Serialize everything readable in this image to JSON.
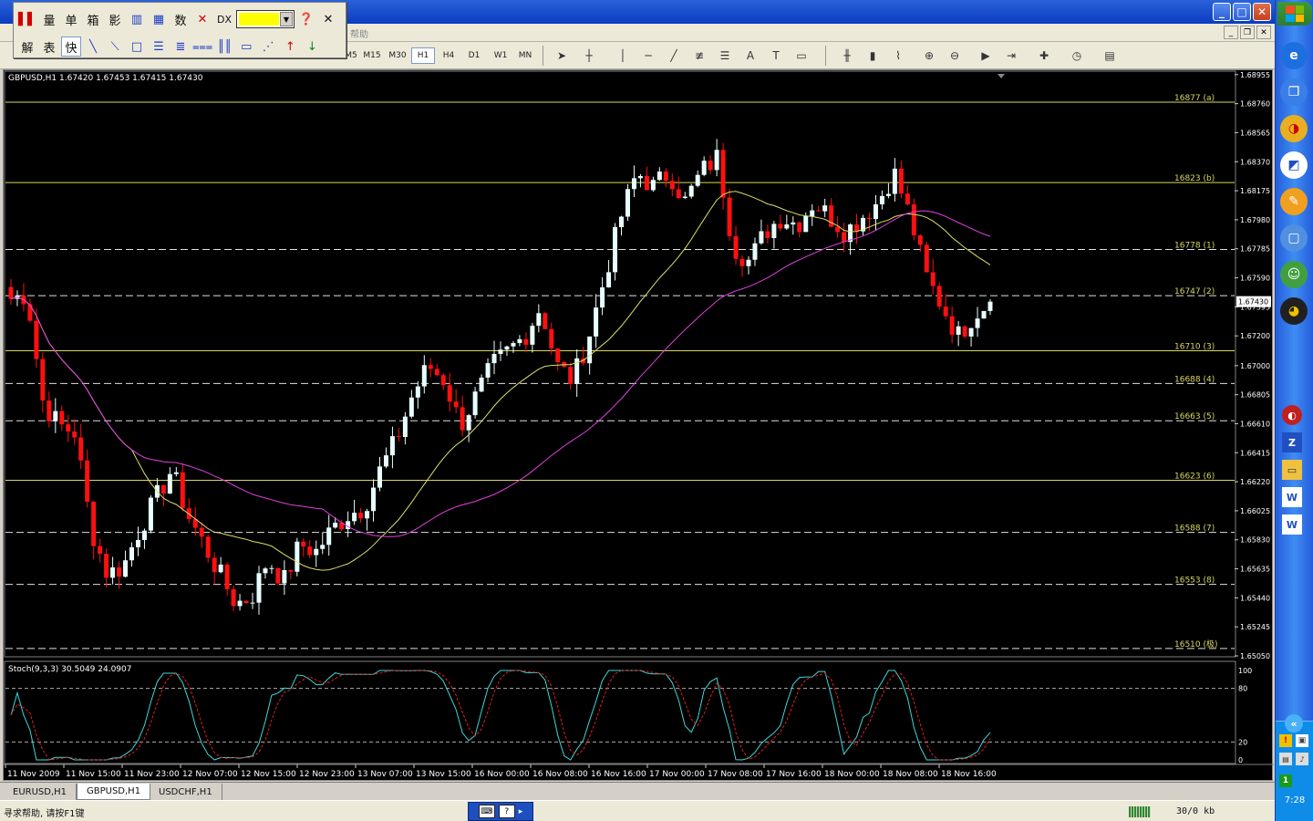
{
  "window": {
    "min_label": "_",
    "max_label": "□",
    "close_label": "✕"
  },
  "menubar": {
    "partial_label": "帮助"
  },
  "floating_toolbar": {
    "row1": [
      "量",
      "单",
      "箱",
      "影",
      "数"
    ],
    "row1_dx": "DX",
    "row2": [
      "解",
      "表",
      "快"
    ],
    "color": "#ffff00"
  },
  "toolbar": {
    "timeframes": [
      "M5",
      "M15",
      "M30",
      "H1",
      "H4",
      "D1",
      "W1",
      "MN"
    ],
    "active_timeframe": "H1"
  },
  "chart": {
    "symbol_info": "GBPUSD,H1  1.67420 1.67453 1.67415 1.67430",
    "current_price": "1.67430",
    "indicator_info": "Stoch(9,3,3) 30.5049 24.0907"
  },
  "chart_data": {
    "type": "candlestick",
    "symbol": "GBPUSD",
    "timeframe": "H1",
    "price_axis_ticks": [
      "1.68955",
      "1.68760",
      "1.68565",
      "1.68370",
      "1.68175",
      "1.67980",
      "1.67785",
      "1.67590",
      "1.67395",
      "1.67200",
      "1.67000",
      "1.66805",
      "1.66610",
      "1.66415",
      "1.66220",
      "1.66025",
      "1.65830",
      "1.65635",
      "1.65440",
      "1.65245",
      "1.65050"
    ],
    "ylim": [
      1.6505,
      1.6896
    ],
    "levels": [
      {
        "label": "16877 (a)",
        "value": 1.6877,
        "style": "solid"
      },
      {
        "label": "16823 (b)",
        "value": 1.6823,
        "style": "solid"
      },
      {
        "label": "16778 (1)",
        "value": 1.6778,
        "style": "dashed"
      },
      {
        "label": "16747 (2)",
        "value": 1.6747,
        "style": "dashed"
      },
      {
        "label": "16710 (3)",
        "value": 1.671,
        "style": "solid"
      },
      {
        "label": "16688 (4)",
        "value": 1.6688,
        "style": "dashed"
      },
      {
        "label": "16663 (5)",
        "value": 1.6663,
        "style": "dashed"
      },
      {
        "label": "16623 (6)",
        "value": 1.6623,
        "style": "solid"
      },
      {
        "label": "16588 (7)",
        "value": 1.6588,
        "style": "dashed"
      },
      {
        "label": "16553 (8)",
        "value": 1.6553,
        "style": "dashed"
      },
      {
        "label": "16510 (极)",
        "value": 1.651,
        "style": "dashed"
      }
    ],
    "time_labels": [
      "11 Nov 2009",
      "11 Nov 15:00",
      "11 Nov 23:00",
      "12 Nov 07:00",
      "12 Nov 15:00",
      "12 Nov 23:00",
      "13 Nov 07:00",
      "13 Nov 15:00",
      "16 Nov 00:00",
      "16 Nov 08:00",
      "16 Nov 16:00",
      "17 Nov 00:00",
      "17 Nov 08:00",
      "17 Nov 16:00",
      "18 Nov 00:00",
      "18 Nov 08:00",
      "18 Nov 16:00"
    ],
    "stoch_ticks": [
      "100",
      "80",
      "20",
      "0"
    ],
    "stoch_value": 30.5049,
    "stoch_signal": 24.0907,
    "candle_close_path": [
      1.6745,
      1.6748,
      1.6675,
      1.666,
      1.6655,
      1.659,
      1.656,
      1.6565,
      1.659,
      1.661,
      1.663,
      1.66,
      1.658,
      1.656,
      1.654,
      1.6545,
      1.657,
      1.6555,
      1.658,
      1.6575,
      1.659,
      1.66,
      1.6605,
      1.663,
      1.665,
      1.668,
      1.67,
      1.669,
      1.666,
      1.668,
      1.67,
      1.671,
      1.672,
      1.674,
      1.67,
      1.669,
      1.672,
      1.676,
      1.68,
      1.683,
      1.682,
      1.683,
      1.681,
      1.683,
      1.684,
      1.678,
      1.677,
      1.679,
      1.68,
      1.6795,
      1.681,
      1.68,
      1.679,
      1.68,
      1.681,
      1.683,
      1.68,
      1.676,
      1.674,
      1.672,
      1.6735,
      1.6743
    ],
    "ma_fast_color": "#dede66",
    "ma_slow_color": "#e040e0",
    "stoch_main_color": "#3fd8d8",
    "stoch_signal_color": "#e02020",
    "bull_color": "#e8ffff",
    "bear_color": "#ff1010",
    "level_color": "#d8d860"
  },
  "tabs": [
    "EURUSD,H1",
    "GBPUSD,H1",
    "USDCHF,H1"
  ],
  "active_tab": "GBPUSD,H1",
  "status": {
    "help": "寻求帮助, 请按F1键",
    "connection": "30/0 kb"
  },
  "clock": "7:28"
}
